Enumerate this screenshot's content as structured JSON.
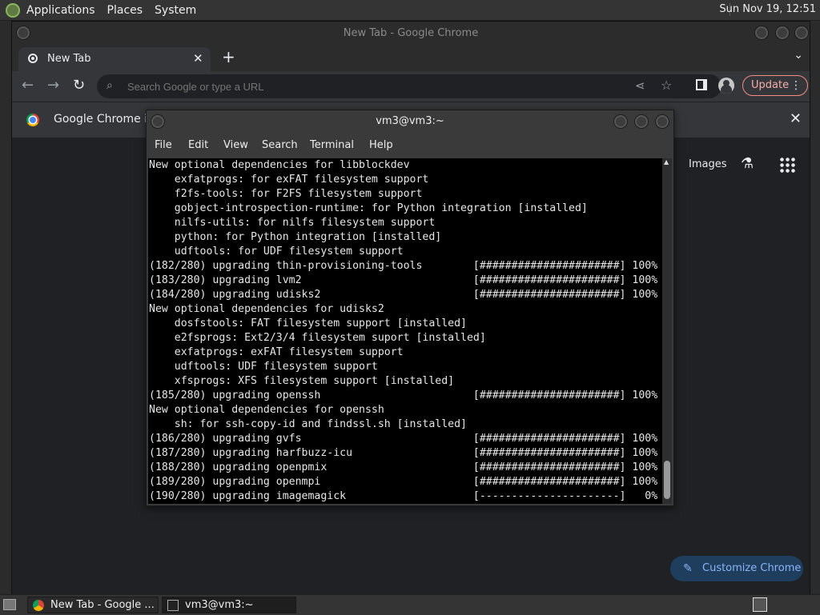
{
  "top_panel": {
    "menus": [
      "Applications",
      "Places",
      "System"
    ],
    "clock": "Sun Nov 19, 12:51"
  },
  "chrome": {
    "window_title": "New Tab - Google Chrome",
    "tab_title": "New Tab",
    "omnibox_placeholder": "Search Google or type a URL",
    "update_label": "Update",
    "infobar_text": "Google Chrome isn",
    "ntp": {
      "images_link": "Images",
      "customize_label": "Customize Chrome"
    }
  },
  "terminal": {
    "title": "vm3@vm3:~",
    "menu": [
      "File",
      "Edit",
      "View",
      "Search",
      "Terminal",
      "Help"
    ],
    "lines": [
      "New optional dependencies for libblockdev",
      "    exfatprogs: for exFAT filesystem support",
      "    f2fs-tools: for F2FS filesystem support",
      "    gobject-introspection-runtime: for Python integration [installed]",
      "    nilfs-utils: for nilfs filesystem support",
      "    python: for Python integration [installed]",
      "    udftools: for UDF filesystem support",
      "(182/280) upgrading thin-provisioning-tools        [######################] 100%",
      "(183/280) upgrading lvm2                           [######################] 100%",
      "(184/280) upgrading udisks2                        [######################] 100%",
      "New optional dependencies for udisks2",
      "    dosfstools: FAT filesystem support [installed]",
      "    e2fsprogs: Ext2/3/4 filesystem suport [installed]",
      "    exfatprogs: exFAT filesystem support",
      "    udftools: UDF filesystem support",
      "    xfsprogs: XFS filesystem support [installed]",
      "(185/280) upgrading openssh                        [######################] 100%",
      "New optional dependencies for openssh",
      "    sh: for ssh-copy-id and findssl.sh [installed]",
      "(186/280) upgrading gvfs                           [######################] 100%",
      "(187/280) upgrading harfbuzz-icu                   [######################] 100%",
      "(188/280) upgrading openpmix                       [######################] 100%",
      "(189/280) upgrading openmpi                        [######################] 100%",
      "(190/280) upgrading imagemagick                    [----------------------]   0%"
    ]
  },
  "taskbar": {
    "tasks": [
      {
        "label": "New Tab - Google ...",
        "icon": "chrome-icon"
      },
      {
        "label": "vm3@vm3:~",
        "icon": "terminal-icon"
      }
    ]
  },
  "colors": {
    "panel": "#343434",
    "chrome_bg": "#202124",
    "update_accent": "#f28b82",
    "customize_accent": "#8ab4f8"
  }
}
